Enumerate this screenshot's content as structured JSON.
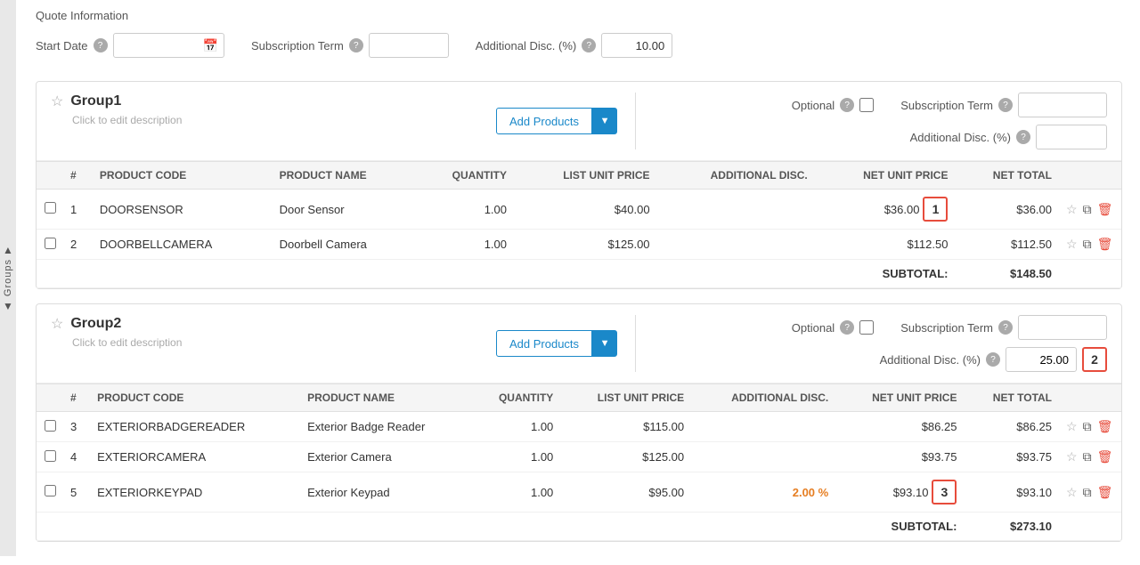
{
  "page": {
    "title": "Quote Information"
  },
  "topBar": {
    "startDateLabel": "Start Date",
    "subscriptionTermLabel": "Subscription Term",
    "additionalDiscLabel": "Additional Disc. (%)",
    "additionalDiscValue": "10.00"
  },
  "leftNav": {
    "groupsLabel": "Groups",
    "arrowUpSymbol": "▲",
    "arrowDownSymbol": "▼"
  },
  "groups": [
    {
      "id": "group1",
      "name": "Group1",
      "description": "Click to edit description",
      "addProductsLabel": "Add Products",
      "optionalLabel": "Optional",
      "additionalDiscLabel": "Additional Disc. (%)",
      "additionalDiscValue": "",
      "subscriptionTermLabel": "Subscription Term",
      "subscriptionTermValue": "",
      "columns": [
        "#",
        "PRODUCT CODE",
        "PRODUCT NAME",
        "QUANTITY",
        "LIST UNIT PRICE",
        "ADDITIONAL DISC.",
        "NET UNIT PRICE",
        "NET TOTAL"
      ],
      "products": [
        {
          "row": 1,
          "code": "DOORSENSOR",
          "name": "Door Sensor",
          "quantity": "1.00",
          "listUnitPrice": "$40.00",
          "additionalDisc": "",
          "netUnitPrice": "$36.00",
          "netTotal": "$36.00",
          "badge": "1"
        },
        {
          "row": 2,
          "code": "DOORBELLCAMERA",
          "name": "Doorbell Camera",
          "quantity": "1.00",
          "listUnitPrice": "$125.00",
          "additionalDisc": "",
          "netUnitPrice": "$112.50",
          "netTotal": "$112.50",
          "badge": null
        }
      ],
      "subtotalLabel": "SUBTOTAL:",
      "subtotalValue": "$148.50"
    },
    {
      "id": "group2",
      "name": "Group2",
      "description": "Click to edit description",
      "addProductsLabel": "Add Products",
      "optionalLabel": "Optional",
      "additionalDiscLabel": "Additional Disc. (%)",
      "additionalDiscValue": "25.00",
      "subscriptionTermLabel": "Subscription Term",
      "subscriptionTermValue": "",
      "columns": [
        "#",
        "PRODUCT CODE",
        "PRODUCT NAME",
        "QUANTITY",
        "LIST UNIT PRICE",
        "ADDITIONAL DISC.",
        "NET UNIT PRICE",
        "NET TOTAL"
      ],
      "products": [
        {
          "row": 3,
          "code": "EXTERIORBADGEREADER",
          "name": "Exterior Badge Reader",
          "quantity": "1.00",
          "listUnitPrice": "$115.00",
          "additionalDisc": "",
          "netUnitPrice": "$86.25",
          "netTotal": "$86.25",
          "badge": null
        },
        {
          "row": 4,
          "code": "EXTERIORCAMERA",
          "name": "Exterior Camera",
          "quantity": "1.00",
          "listUnitPrice": "$125.00",
          "additionalDisc": "",
          "netUnitPrice": "$93.75",
          "netTotal": "$93.75",
          "badge": null
        },
        {
          "row": 5,
          "code": "EXTERIORKEYPAD",
          "name": "Exterior Keypad",
          "quantity": "1.00",
          "listUnitPrice": "$95.00",
          "additionalDisc": "2.00 %",
          "netUnitPrice": "$93.10",
          "netTotal": "$93.10",
          "badge": "3"
        }
      ],
      "subtotalLabel": "SUBTOTAL:",
      "subtotalValue": "$273.10",
      "discBadge": "2"
    }
  ],
  "icons": {
    "help": "?",
    "calendar": "📅",
    "star": "☆",
    "starFilled": "★",
    "copy": "⧉",
    "delete": "🗑",
    "dropdown": "▼"
  }
}
